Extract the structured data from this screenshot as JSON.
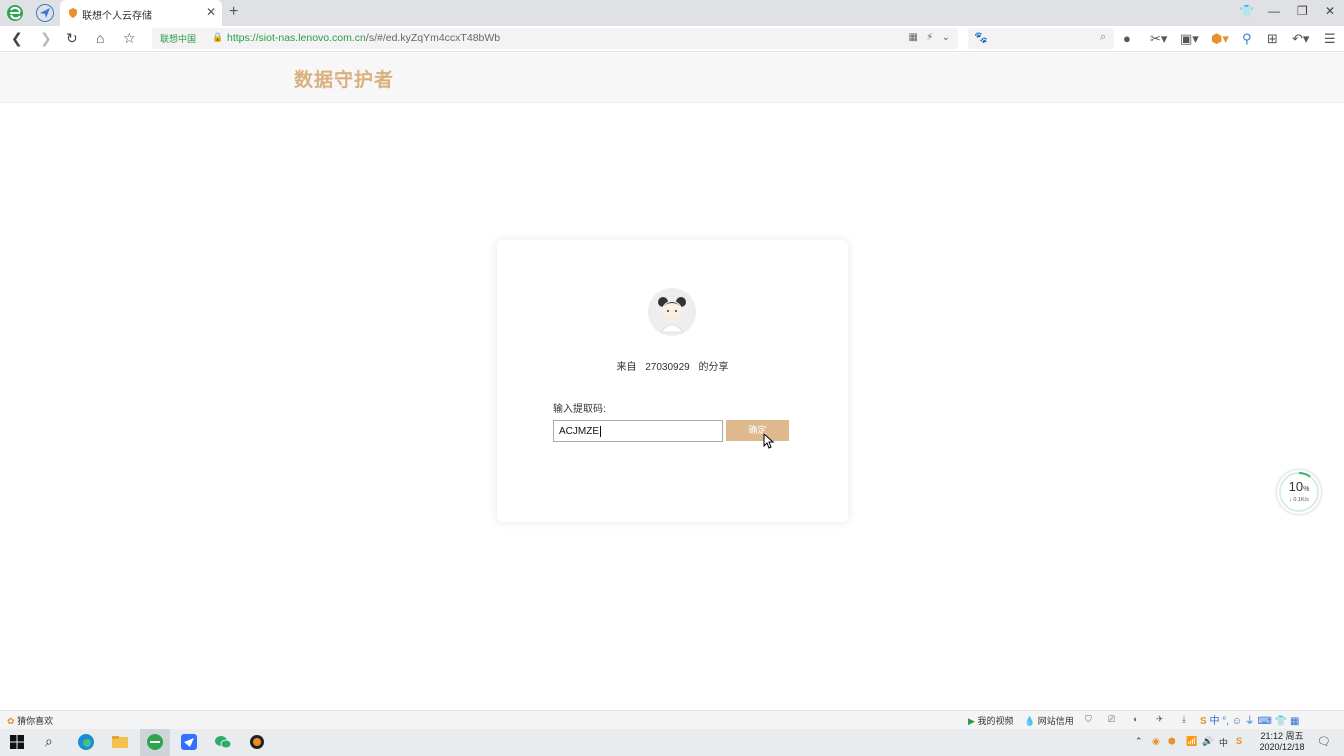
{
  "browser": {
    "tab_title": "联想个人云存储",
    "url_cert": "联想中国",
    "url_host": "https://siot-nas.lenovo.com.cn",
    "url_path": "/s/#/ed.kyZqYm4ccxT48bWb",
    "search_placeholder": "",
    "icons": [
      "edge-logo-icon",
      "send-icon",
      "shield-icon",
      "close-icon",
      "plus-icon",
      "back-icon",
      "forward-icon",
      "refresh-icon",
      "home-icon",
      "star-icon",
      "lock-icon",
      "search-icon",
      "menu-icon"
    ]
  },
  "page": {
    "brand": "数据守护者",
    "share": {
      "from_prefix": "来自",
      "user_id": "27030929",
      "from_suffix": "的分享"
    },
    "code_label": "输入提取码:",
    "code_value": "ACJMZE",
    "confirm_label": "确定"
  },
  "gauge": {
    "percent": "10",
    "percent_unit": "%",
    "speed": "↓ 0.1K/s",
    "level": 0.1
  },
  "statusbar": {
    "left_label": "猜你喜欢",
    "video_label": "我的视频",
    "credit_label": "网站信用"
  },
  "taskbar": {
    "time": "21:12 周五",
    "date": "2020/12/18",
    "ime_lang": "中"
  },
  "colors": {
    "brand": "#d9b07e",
    "confirm": "#ddb98d",
    "url_green": "#2a9a4a"
  }
}
